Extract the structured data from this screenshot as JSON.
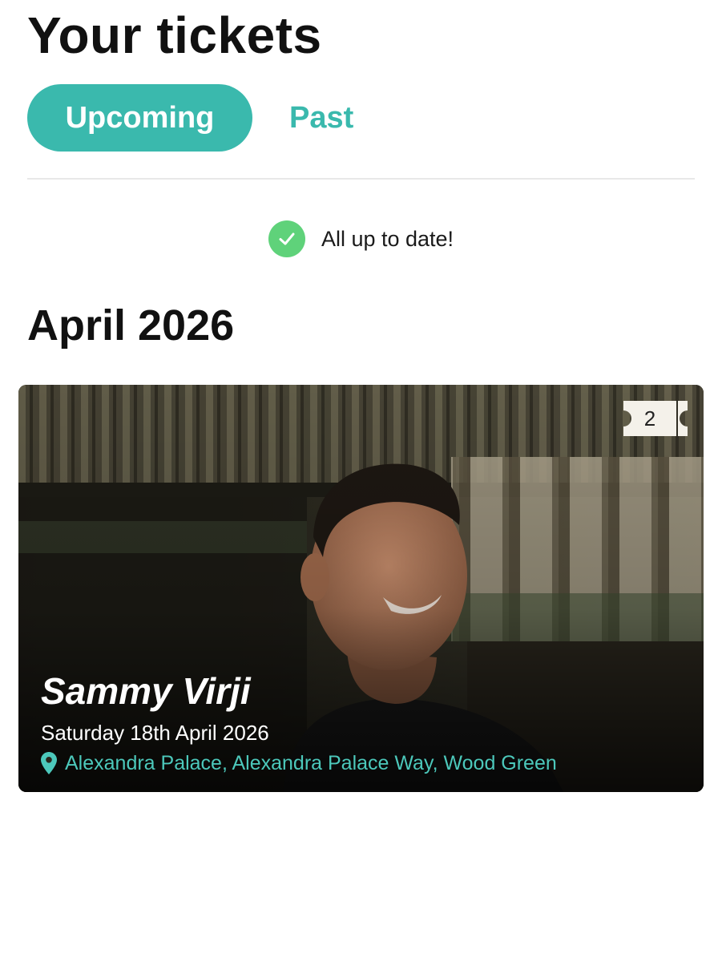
{
  "page": {
    "title": "Your tickets"
  },
  "tabs": {
    "upcoming": "Upcoming",
    "past": "Past",
    "active": "upcoming"
  },
  "status": {
    "text": "All up to date!",
    "icon": "check-circle-icon"
  },
  "sections": [
    {
      "heading": "April 2026",
      "events": [
        {
          "artist": "Sammy Virji",
          "date": "Saturday 18th April 2026",
          "venue": "Alexandra Palace, Alexandra Palace Way, Wood Green",
          "ticket_count": "2",
          "icons": {
            "venue": "location-pin-icon",
            "tickets": "ticket-icon"
          }
        }
      ]
    }
  ],
  "colors": {
    "accent": "#3ab9ad",
    "status_ok": "#5fd27a",
    "venue_text": "#4cc8bb"
  }
}
